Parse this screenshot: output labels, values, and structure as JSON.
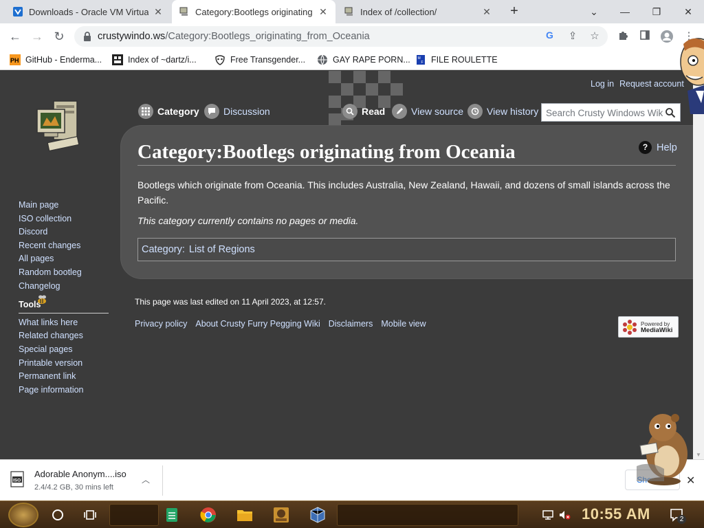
{
  "browser": {
    "tabs": [
      {
        "label": "Downloads - Oracle VM Virtual",
        "active": false
      },
      {
        "label": "Category:Bootlegs originating f",
        "active": true
      },
      {
        "label": "Index of /collection/",
        "active": false
      }
    ],
    "url_domain": "crustywindo.ws",
    "url_path": "/Category:Bootlegs_originating_from_Oceania",
    "bookmarks": [
      {
        "label": "GitHub - Enderma...",
        "icon": "ph-logo-icon"
      },
      {
        "label": "Index of ~dartz/i...",
        "icon": "index-icon"
      },
      {
        "label": "Free Transgender...",
        "icon": "mask-icon"
      },
      {
        "label": "GAY RAPE PORN...",
        "icon": "globe-icon"
      },
      {
        "label": "FILE ROULETTE",
        "icon": "file-icon"
      }
    ]
  },
  "wiki": {
    "personal": {
      "login": "Log in",
      "request": "Request account"
    },
    "sidebar": {
      "nav": [
        "Main page",
        "ISO collection",
        "Discord",
        "Recent changes",
        "All pages",
        "Random bootleg",
        "Changelog"
      ],
      "tools_heading": "Tools",
      "tools": [
        "What links here",
        "Related changes",
        "Special pages",
        "Printable version",
        "Permanent link",
        "Page information"
      ]
    },
    "tabs": {
      "category": "Category",
      "discussion": "Discussion",
      "read": "Read",
      "view_source": "View source",
      "view_history": "View history"
    },
    "search_placeholder": "Search Crusty Windows Wiki",
    "help": "Help",
    "title": "Category:Bootlegs originating from Oceania",
    "description": "Bootlegs which originate from Oceania. This includes Australia, New Zealand, Hawaii, and dozens of small islands across the Pacific.",
    "empty_note": "This category currently contains no pages or media.",
    "catlinks_label": "Category:",
    "catlinks_value": "List of Regions",
    "last_edited": "This page was last edited on 11 April 2023, at 12:57.",
    "footer_links": [
      "Privacy policy",
      "About Crusty Furry Pegging Wiki",
      "Disclaimers",
      "Mobile view"
    ],
    "powered_by_line1": "Powered by",
    "powered_by_line2": "MediaWiki"
  },
  "downloads": {
    "file_name": "Adorable Anonym....iso",
    "status": "2.4/4.2 GB, 30 mins left",
    "show_all": "Show all"
  },
  "taskbar": {
    "clock": "10:55 AM",
    "notification_count": "2"
  },
  "colors": {
    "wiki_bg": "#3b3b3b",
    "content_bg": "#525252",
    "link": "#cfe0ff",
    "taskbar": "#4a3018"
  }
}
